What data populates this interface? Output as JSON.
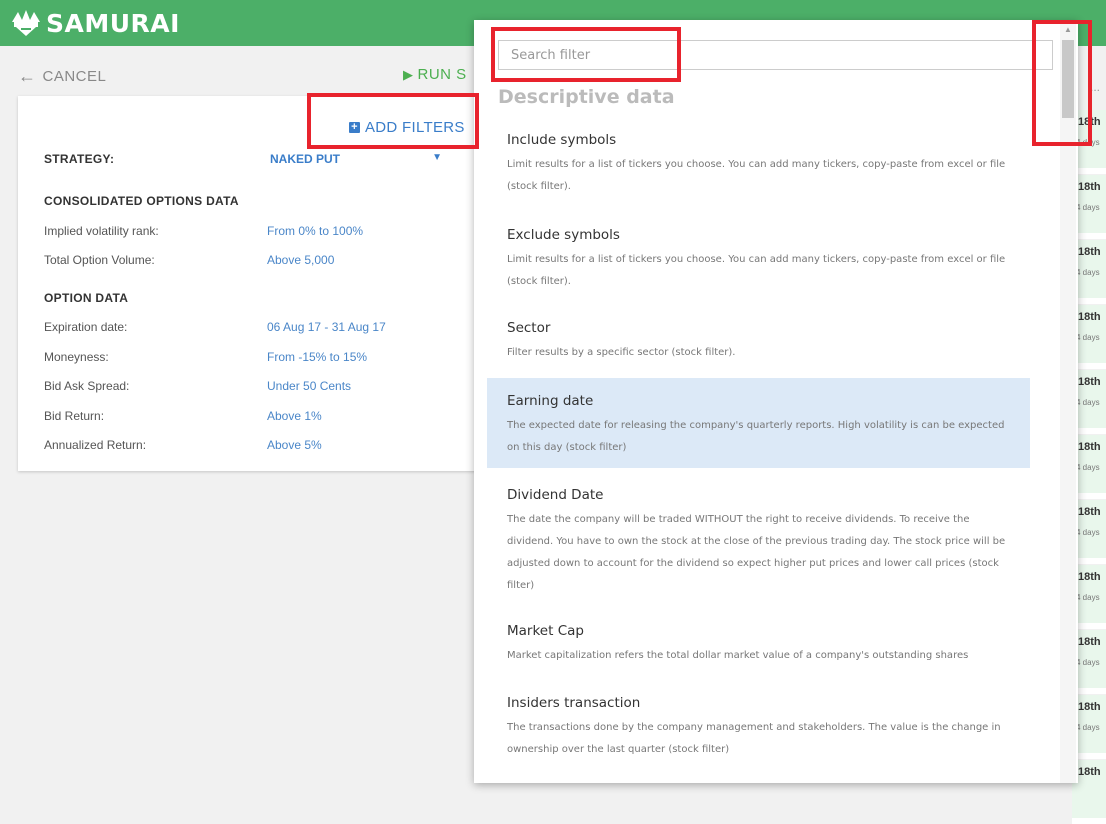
{
  "header": {
    "brand": "SAMURAI"
  },
  "nav": {
    "cancel": "CANCEL",
    "run": "RUN S"
  },
  "filters_card": {
    "add_filters": "ADD FILTERS",
    "strategy_label": "STRATEGY:",
    "strategy_value": "NAKED PUT",
    "consolidated_header": "CONSOLIDATED OPTIONS DATA",
    "option_header": "OPTION DATA",
    "rows": [
      {
        "label": "Implied volatility rank:",
        "value": "From 0% to 100%"
      },
      {
        "label": "Total Option Volume:",
        "value": "Above 5,000"
      },
      {
        "label": "Expiration date:",
        "value": "06 Aug 17 - 31 Aug 17"
      },
      {
        "label": "Moneyness:",
        "value": "From -15% to 15%"
      },
      {
        "label": "Bid Ask Spread:",
        "value": "Under 50 Cents"
      },
      {
        "label": "Bid Return:",
        "value": "Above 1%"
      },
      {
        "label": "Annualized Return:",
        "value": "Above 5%"
      }
    ]
  },
  "results_strip": {
    "item_title": "18th",
    "item_sub": "4 days",
    "more": "..."
  },
  "dropdown": {
    "search_placeholder": "Search filter",
    "section_title": "Descriptive data",
    "items": [
      {
        "title": "Include symbols",
        "desc": "Limit results for a list of tickers you choose. You can add many tickers, copy-paste from excel or file (stock filter)."
      },
      {
        "title": "Exclude symbols",
        "desc": "Limit results for a list of tickers you choose. You can add many tickers, copy-paste from excel or file (stock filter)."
      },
      {
        "title": "Sector",
        "desc": "Filter results by a specific sector (stock filter)."
      },
      {
        "title": "Earning date",
        "desc": "The expected date for releasing the company's quarterly reports. High volatility is can be expected on this day (stock filter)"
      },
      {
        "title": "Dividend Date",
        "desc": "The date the company will be traded WITHOUT the right to receive dividends. To receive the dividend. You have to own the stock at the close of the previous trading day. The stock price will be adjusted down to account for the dividend so expect higher put prices and lower call prices (stock filter)"
      },
      {
        "title": "Market Cap",
        "desc": "Market capitalization refers the total dollar market value of a company's outstanding shares"
      },
      {
        "title": "Insiders transaction",
        "desc": "The transactions done by the company management and stakeholders. The value is the change in ownership over the last quarter (stock filter)"
      }
    ]
  },
  "colors": {
    "brand_green": "#4caf68",
    "link_blue": "#3a7dc9",
    "highlight_red": "#e8232d",
    "selected_row": "#dce9f7"
  }
}
